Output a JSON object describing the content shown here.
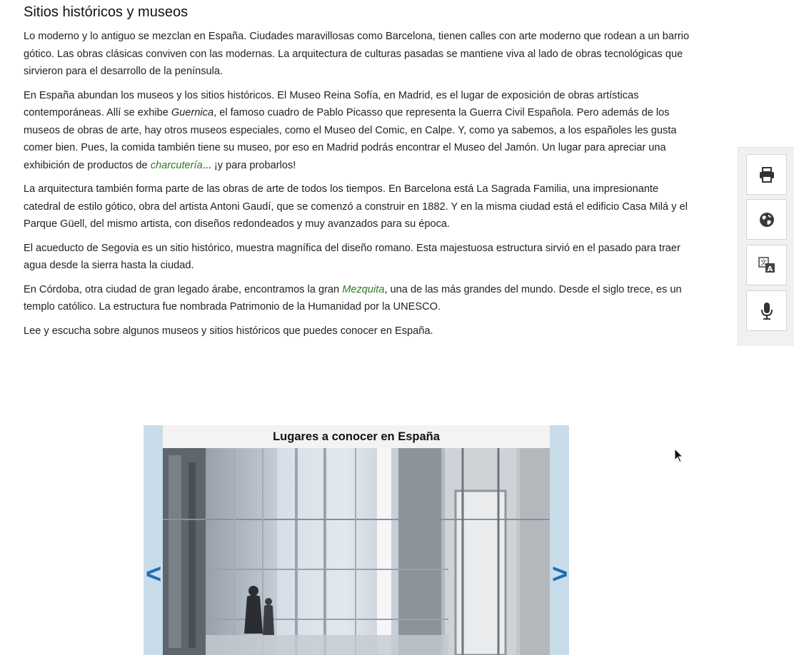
{
  "article": {
    "title": "Sitios históricos y museos",
    "p1": "Lo moderno y lo antiguo se mezclan en España. Ciudades maravillosas como Barcelona, tienen calles con arte moderno que rodean a un barrio gótico. Las obras clásicas conviven con las modernas. La arquitectura de culturas pasadas se mantiene viva al lado de obras tecnológicas que sirvieron para el desarrollo de la península.",
    "p2_a": "En España abundan los museos y los sitios históricos. El Museo Reina Sofía, en Madrid, es el lugar de exposición de obras artísticas contemporáneas. Allí se exhibe ",
    "p2_em": "Guernica",
    "p2_b": ", el famoso cuadro de Pablo Picasso que representa la Guerra Civil Española. Pero además de los museos de obras de arte, hay otros museos especiales, como el Museo del Comic, en Calpe. Y, como ya sabemos, a los españoles les gusta comer bien. Pues, la comida también tiene su museo, por eso en Madrid podrás encontrar el Museo del Jamón. Un lugar para apreciar una exhibición de productos de ",
    "p2_link": "charcutería",
    "p2_c": "... ¡y para probarlos!",
    "p3": "La arquitectura también forma parte de las obras de arte de todos los tiempos. En Barcelona está La Sagrada Familia, una impresionante catedral de estilo gótico, obra del artista Antoni Gaudí, que se comenzó a construir en 1882. Y en la misma ciudad está el edificio Casa Milá y el Parque Güell, del mismo artista, con diseños redondeados y muy avanzados para su época.",
    "p4": "El acueducto de Segovia es un sitio histórico, muestra magnífica del diseño romano. Esta majestuosa estructura sirvió en el pasado para traer agua desde la sierra hasta la ciudad.",
    "p5_a": "En Córdoba, otra ciudad de gran legado árabe, encontramos la gran ",
    "p5_link": "Mezquita",
    "p5_b": ", una de las más grandes del mundo. Desde el siglo trece, es un templo católico. La estructura fue nombrada Patrimonio de la Humanidad por la UNESCO.",
    "p6": "Lee y escucha sobre algunos museos y sitios históricos que puedes conocer en España."
  },
  "slideshow": {
    "title": "Lugares a conocer en España",
    "prev_label": "<",
    "next_label": ">",
    "image_icon": "museum-glass-elevator-photo"
  },
  "tools": {
    "items": [
      {
        "icon": "print-icon"
      },
      {
        "icon": "globe-icon"
      },
      {
        "icon": "translate-icon"
      },
      {
        "icon": "microphone-icon"
      }
    ]
  },
  "colors": {
    "glossary_link": "#2d7a1f",
    "nav_arrow": "#1b6fb3",
    "slideshow_frame": "#c9dcea"
  }
}
